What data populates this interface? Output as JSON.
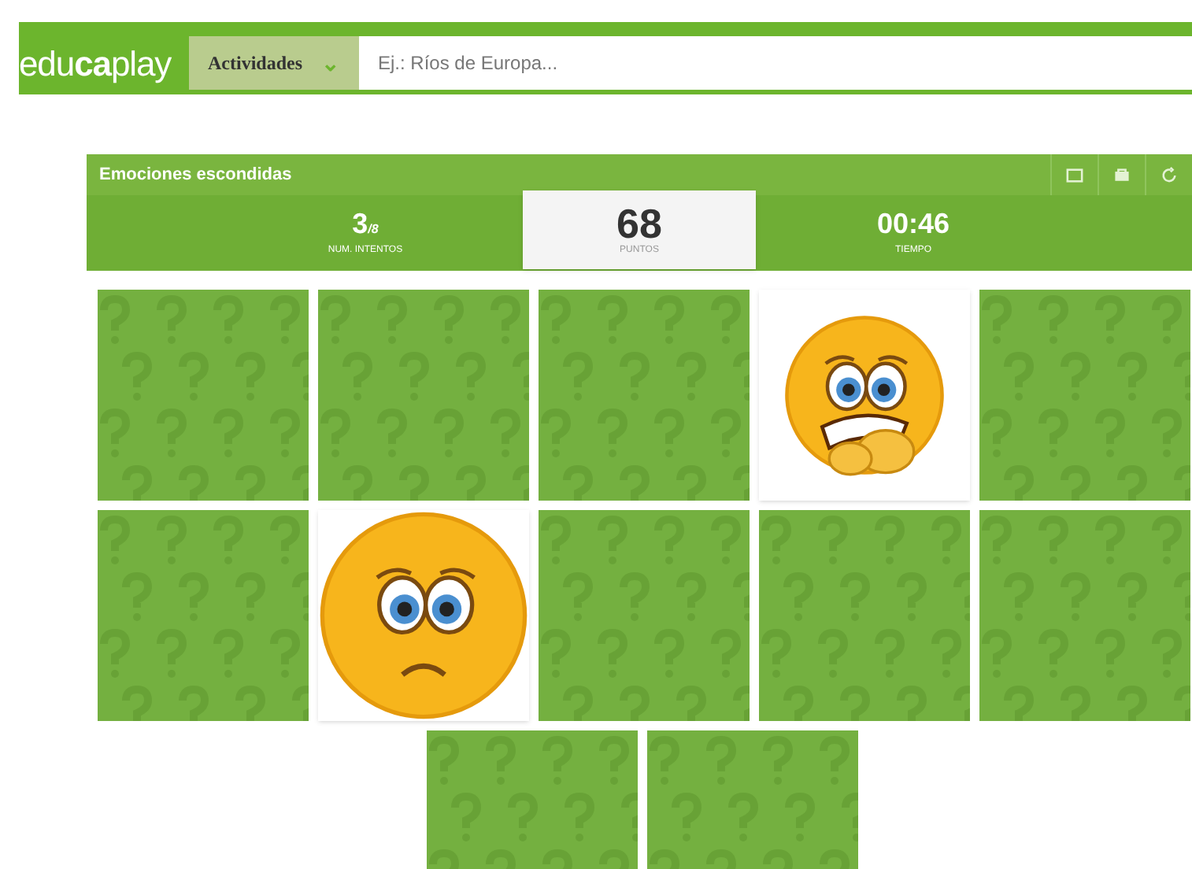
{
  "header": {
    "logo": [
      "edu",
      "ca",
      "play"
    ],
    "category": {
      "label": "Actividades",
      "caret": "⌄"
    },
    "search": {
      "placeholder": "Ej.: Ríos de Europa..."
    }
  },
  "game": {
    "title": "Emociones escondidas",
    "stats": [
      {
        "kind": "attempts",
        "value": "3",
        "suffix": "/8",
        "label": "NUM. INTENTOS"
      },
      {
        "kind": "score",
        "value": "68",
        "label": "PUNTOS"
      },
      {
        "kind": "time",
        "value": "00:46",
        "label": "TIEMPO"
      }
    ],
    "cards": [
      {
        "kind": "hidden"
      },
      {
        "kind": "hidden"
      },
      {
        "kind": "hidden"
      },
      {
        "kind": "fearful"
      },
      {
        "kind": "hidden"
      },
      {
        "kind": "hidden"
      },
      {
        "kind": "sad"
      },
      {
        "kind": "hidden"
      },
      {
        "kind": "hidden"
      },
      {
        "kind": "hidden"
      },
      {
        "kind": "hidden"
      },
      {
        "kind": "hidden"
      }
    ]
  }
}
